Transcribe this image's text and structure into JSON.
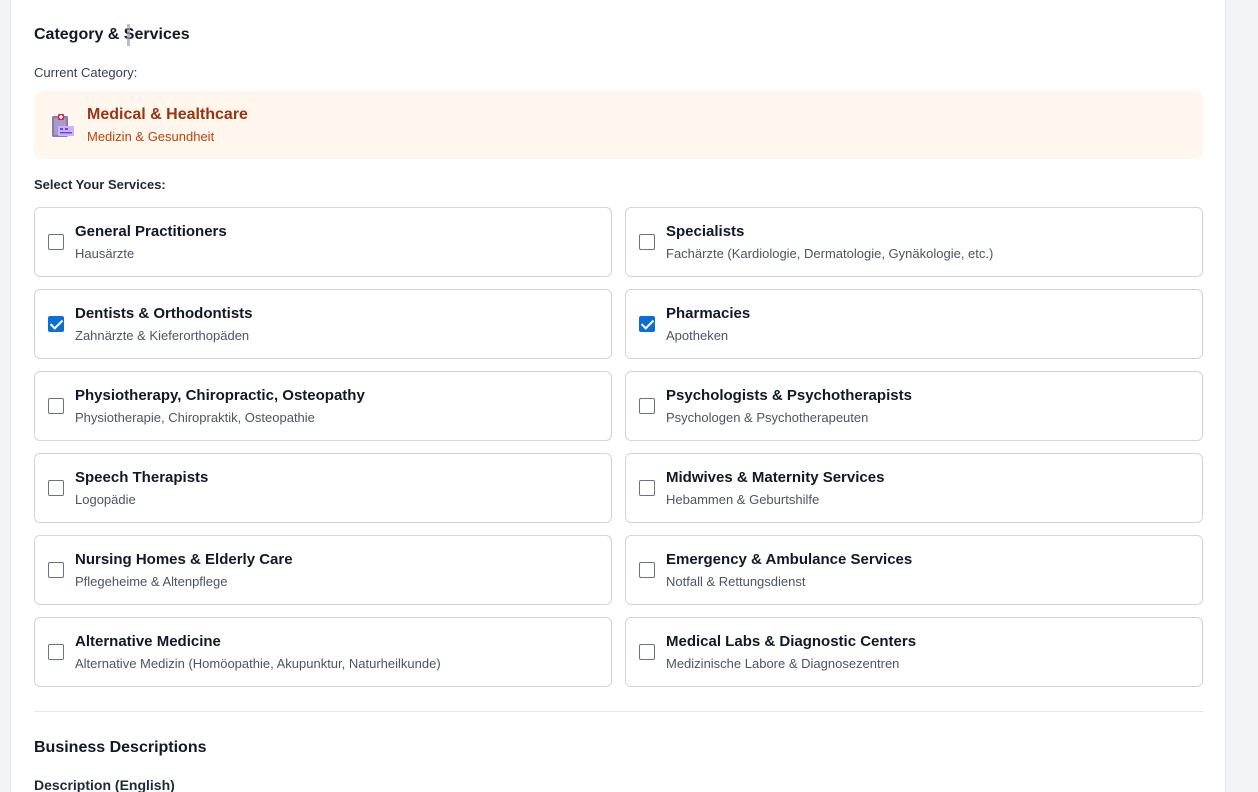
{
  "section": {
    "title": "Category & Services"
  },
  "current_category": {
    "label": "Current Category:",
    "icon": "hospital-icon",
    "name_en": "Medical & Healthcare",
    "name_de": "Medizin & Gesundheit"
  },
  "services": {
    "label": "Select Your Services:",
    "items": [
      {
        "title": "General Practitioners",
        "subtitle": "Hausärzte",
        "checked": false
      },
      {
        "title": "Specialists",
        "subtitle": "Fachärzte (Kardiologie, Dermatologie, Gynäkologie, etc.)",
        "checked": false
      },
      {
        "title": "Dentists & Orthodontists",
        "subtitle": "Zahnärzte & Kieferorthopäden",
        "checked": true
      },
      {
        "title": "Pharmacies",
        "subtitle": "Apotheken",
        "checked": true
      },
      {
        "title": "Physiotherapy, Chiropractic, Osteopathy",
        "subtitle": "Physiotherapie, Chiropraktik, Osteopathie",
        "checked": false
      },
      {
        "title": "Psychologists & Psychotherapists",
        "subtitle": "Psychologen & Psychotherapeuten",
        "checked": false
      },
      {
        "title": "Speech Therapists",
        "subtitle": "Logopädie",
        "checked": false
      },
      {
        "title": "Midwives & Maternity Services",
        "subtitle": "Hebammen & Geburtshilfe",
        "checked": false
      },
      {
        "title": "Nursing Homes & Elderly Care",
        "subtitle": "Pflegeheime & Altenpflege",
        "checked": false
      },
      {
        "title": "Emergency & Ambulance Services",
        "subtitle": "Notfall & Rettungsdienst",
        "checked": false
      },
      {
        "title": "Alternative Medicine",
        "subtitle": "Alternative Medizin (Homöopathie, Akupunktur, Naturheilkunde)",
        "checked": false
      },
      {
        "title": "Medical Labs & Diagnostic Centers",
        "subtitle": "Medizinische Labore & Diagnosezentren",
        "checked": false
      }
    ]
  },
  "descriptions": {
    "title": "Business Descriptions",
    "english_label": "Description (English)"
  },
  "colors": {
    "accent": "#0b6fd6",
    "category_bg": "#fff7ed",
    "category_title": "#9a3412",
    "category_sub": "#c2410c"
  }
}
